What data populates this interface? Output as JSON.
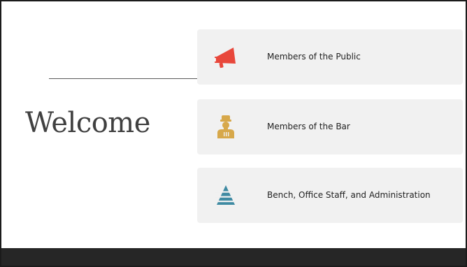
{
  "slide": {
    "title": "Welcome",
    "options": [
      {
        "label": "Members of the Public",
        "icon": "megaphone-icon",
        "icon_color": "#e8473b"
      },
      {
        "label": "Members of the Bar",
        "icon": "chef-person-icon",
        "icon_color": "#d7a84a"
      },
      {
        "label": "Bench, Office Staff, and Administration",
        "icon": "pyramid-icon",
        "icon_color": "#3e8aa2"
      }
    ]
  },
  "colors": {
    "card_background": "#f1f1f1",
    "footer_bar": "#262626",
    "title_text": "#404040"
  }
}
